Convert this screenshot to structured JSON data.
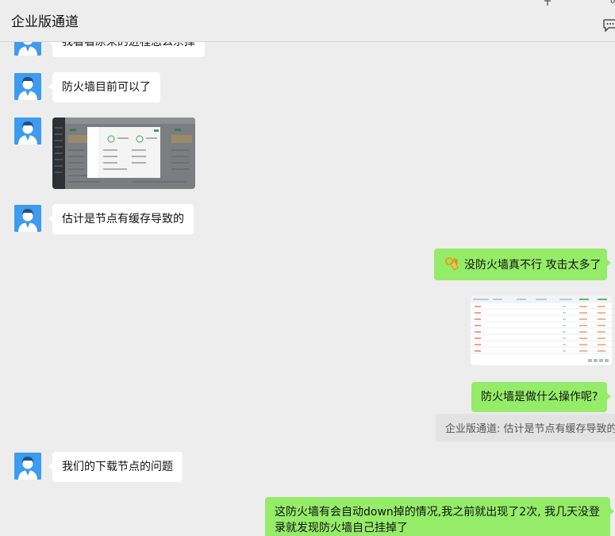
{
  "window": {
    "title": "企业版通道"
  },
  "messages": {
    "m1": "我看看原来的进程怎么杀掉",
    "m2": "防火墙目前可以了",
    "m4": "估计是节点有缓存导致的",
    "m5": "没防火墙真不行 攻击太多了",
    "m7": "防火墙是做什么操作呢?",
    "m7_quote": "企业版通道: 估计是节点有缓存导致的",
    "m8": "我们的下载节点的问题",
    "m9": "这防火墙有会自动down掉的情况,我之前就出现了2次, 我几天没登录就发现防火墙自己挂掉了"
  },
  "theme": {
    "bg": "#ededed",
    "incoming_bubble": "#ffffff",
    "outgoing_bubble": "#95ec69",
    "avatar": "#3d9bf0"
  },
  "icons": {
    "pin": "pin-icon",
    "more": "chat-bubble-icon",
    "emoji": "ok-hand-emoji-icon",
    "avatar": "user-avatar-icon"
  }
}
